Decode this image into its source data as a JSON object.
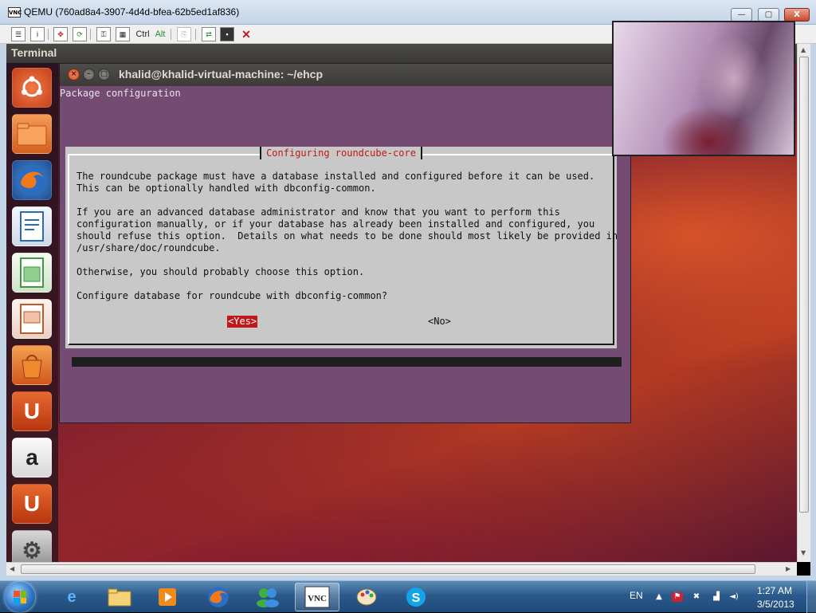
{
  "vnc_window": {
    "title": "QEMU (760ad8a4-3907-4d4d-bfea-62b5ed1af836)",
    "app_icon": "vnc-viewer-icon",
    "controls": {
      "minimize": "—",
      "maximize": "▢",
      "close": "X"
    }
  },
  "toolbar": {
    "items": [
      "options-icon",
      "info-icon",
      "fullscreen-icon",
      "refresh-icon",
      "ctrl-alt-del-icon",
      "connection-icon"
    ],
    "ctrl_label": "Ctrl",
    "alt_label": "Alt",
    "more_items": [
      "clipboard-icon",
      "transfer-icon",
      "save-icon",
      "disconnect-icon"
    ]
  },
  "ubuntu": {
    "panel_title": "Terminal",
    "launcher": [
      {
        "name": "ubuntu-dash-icon",
        "glyph": "◎",
        "color": "#e05a2b"
      },
      {
        "name": "files-icon",
        "glyph": "",
        "color": "#e8793b"
      },
      {
        "name": "firefox-icon",
        "glyph": "",
        "color": "#e56f1f"
      },
      {
        "name": "writer-icon",
        "glyph": "",
        "color": "#2d6bb0"
      },
      {
        "name": "calc-icon",
        "glyph": "",
        "color": "#3e9a3e"
      },
      {
        "name": "impress-icon",
        "glyph": "",
        "color": "#c4562a"
      },
      {
        "name": "software-center-icon",
        "glyph": "",
        "color": "#e06d22"
      },
      {
        "name": "ubuntu-one-icon",
        "glyph": "U",
        "color": "#d24a1e"
      },
      {
        "name": "amazon-icon",
        "glyph": "a",
        "color": "#ececec"
      },
      {
        "name": "ubuntu-one-music-icon",
        "glyph": "U",
        "color": "#d24a1e"
      },
      {
        "name": "system-settings-icon",
        "glyph": "⚙",
        "color": "#9b9b9b"
      }
    ]
  },
  "terminal": {
    "title": "khalid@khalid-virtual-machine: ~/ehcp",
    "header_line": "Package configuration"
  },
  "dialog": {
    "title": "Configuring roundcube-core",
    "body": "The roundcube package must have a database installed and configured before it can be used.\nThis can be optionally handled with dbconfig-common.\n\nIf you are an advanced database administrator and know that you want to perform this\nconfiguration manually, or if your database has already been installed and configured, you\nshould refuse this option.  Details on what needs to be done should most likely be provided in\n/usr/share/doc/roundcube.\n\nOtherwise, you should probably choose this option.\n\nConfigure database for roundcube with dbconfig-common?",
    "yes_label": "<Yes>",
    "no_label": "<No>"
  },
  "taskbar": {
    "apps": [
      "ie-icon",
      "explorer-icon",
      "media-player-icon",
      "firefox-icon",
      "messenger-icon",
      "vnc-icon",
      "paint-icon",
      "skype-icon"
    ],
    "active_app": "vnc-icon",
    "language": "EN",
    "time": "1:27 AM",
    "date": "3/5/2013"
  }
}
